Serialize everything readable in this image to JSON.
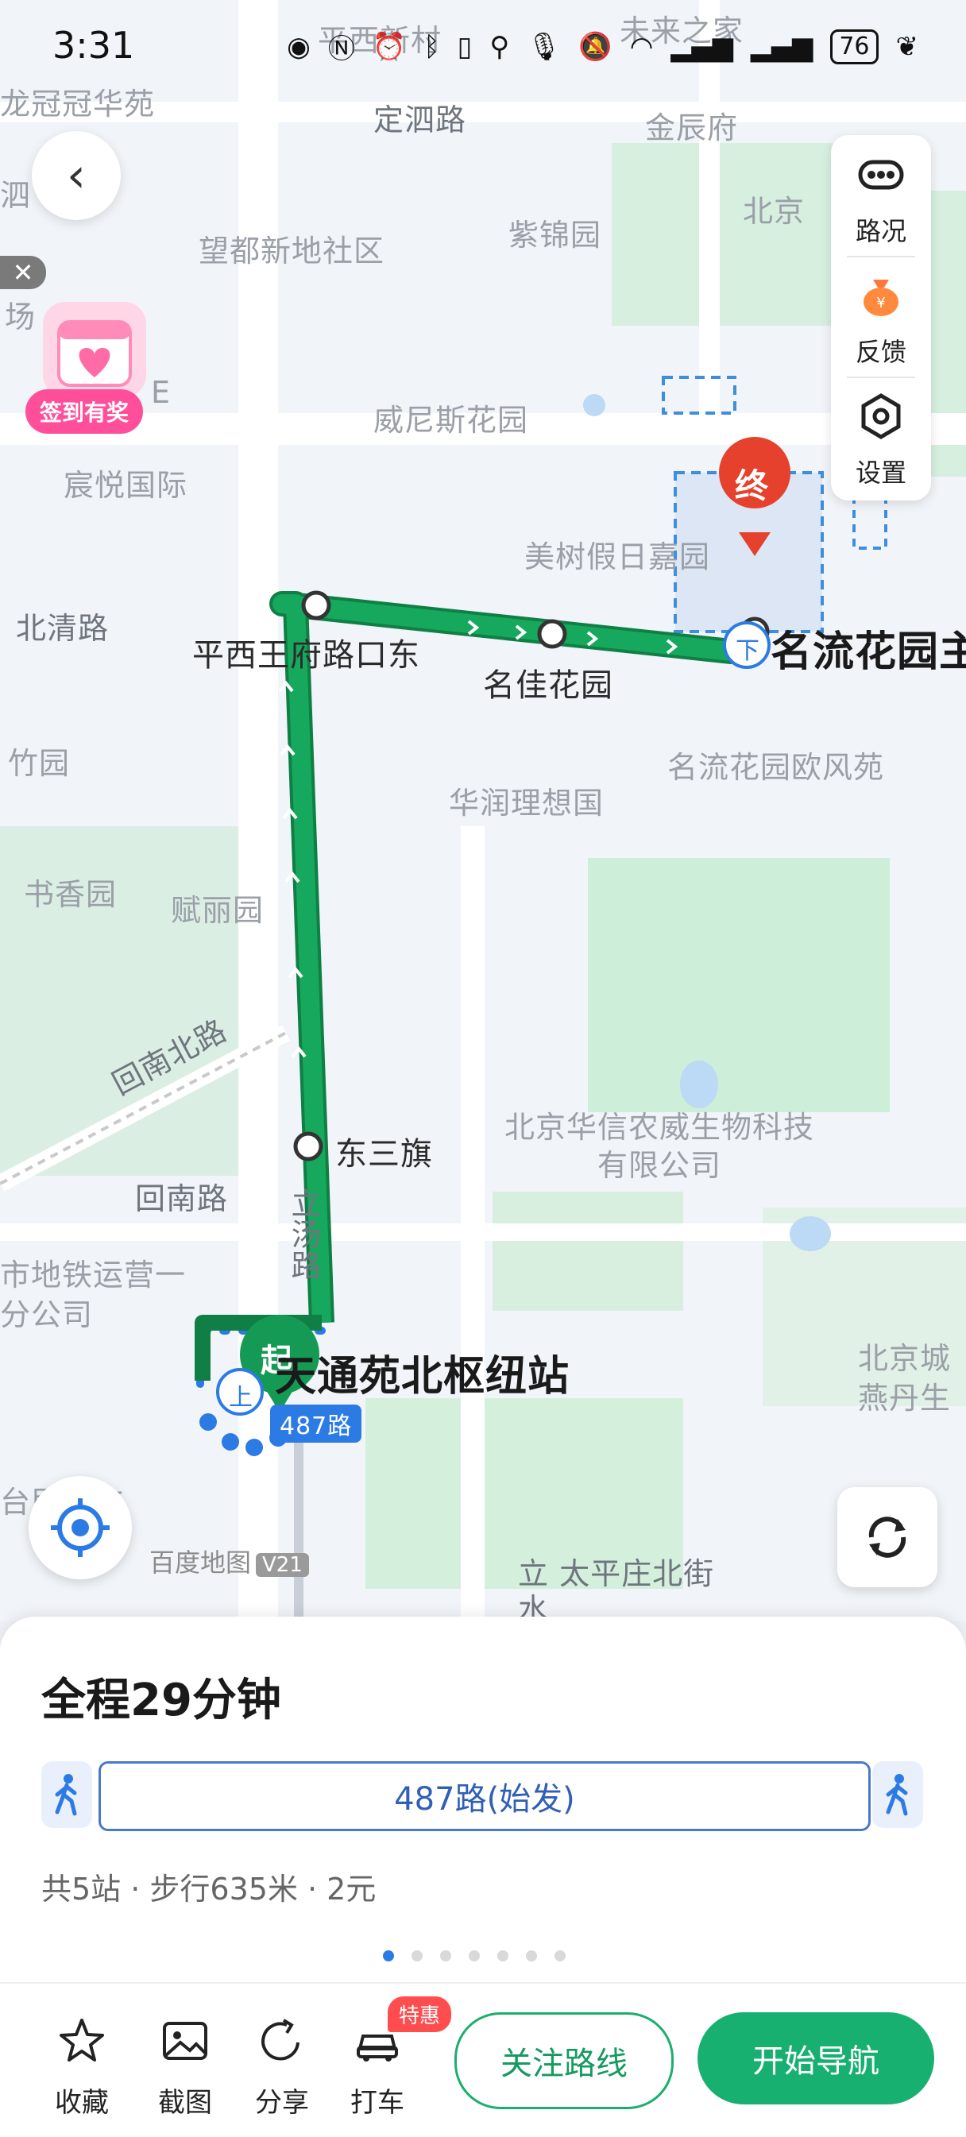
{
  "status_bar": {
    "time": "3:31",
    "battery": "76"
  },
  "map": {
    "labels": {
      "longguan": "龙冠冠华苑",
      "pingxi_top": "平西新村",
      "weilai": "未来之家",
      "dingsi": "定泗路",
      "jinchen": "金辰府",
      "wangdu": "望都新地社区",
      "zijin": "紫锦园",
      "beijing_tr": "北京",
      "weinisi": "威尼斯花园",
      "chenyue": "宸悦国际",
      "meishu": "美树假日嘉园",
      "beiqing": "北清路",
      "zhuyuan": "竹园",
      "huarun": "华润理想国",
      "mingliu_ouf": "名流花园欧风苑",
      "shuxiang": "书香园",
      "fuli": "赋丽园",
      "huinan_bei": "回南北路",
      "huinan": "回南路",
      "huaxin": "北京华信农威生物科技有限公司",
      "lishui": "立汤路",
      "ditie": "市地铁运营一分公司",
      "beijing_br": "北京城燕丹生",
      "zaoshi": "台民早市",
      "taiping": "立 太平庄北街",
      "shui": "水",
      "chang": "场",
      "e_letter": "E",
      "si": "泗"
    },
    "stops": {
      "pingxi": "平西王府路口东",
      "mingjia": "名佳花园",
      "dongsanqi": "东三旗",
      "end_station": "名流花园主",
      "start_station": "天通苑北枢纽站",
      "route_tag": "487路"
    },
    "markers": {
      "start": "起",
      "end": "终",
      "board": "上",
      "alight": "下"
    },
    "checkin": "签到有奖",
    "side_panel": {
      "traffic": "路况",
      "feedback": "反馈",
      "settings": "设置"
    },
    "watermark": "百度地图",
    "watermark_ver": "V21"
  },
  "sheet": {
    "duration": "全程29分钟",
    "route": "487路(始发)",
    "summary": "共5站 · 步行635米 · 2元",
    "page_count": 7,
    "active_page": 0
  },
  "bottom_bar": {
    "favorite": "收藏",
    "screenshot": "截图",
    "share": "分享",
    "taxi": "打车",
    "taxi_badge": "特惠",
    "follow": "关注路线",
    "navigate": "开始导航"
  },
  "colors": {
    "route": "#16a85c",
    "accent": "#18b070",
    "blue": "#2c7be5",
    "marker_red": "#e5412d"
  }
}
